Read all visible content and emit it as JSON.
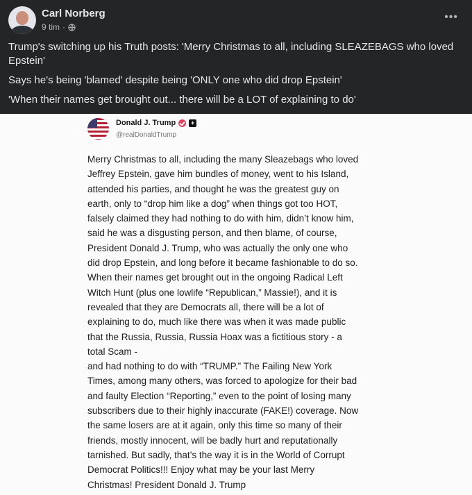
{
  "post": {
    "author": "Carl Norberg",
    "time": "9 tim",
    "separator": "·",
    "privacy_icon": "globe-icon",
    "more_icon": "more-options-icon",
    "more_label": "•••",
    "paragraphs": [
      "Trump's switching up his Truth posts: 'Merry Christmas to all, including SLEAZEBAGS who loved Epstein'",
      "Says he's being 'blamed' despite being 'ONLY one who did drop Epstein'",
      "'When their names get brought out... there will be a LOT of explaining to do'"
    ]
  },
  "truth": {
    "name": "Donald J. Trump",
    "handle": "@realDonaldTrump",
    "plus_label": "+",
    "lines": [
      "Merry Christmas to all, including the many Sleazebags who loved",
      "Jeffrey Epstein, gave him bundles of money, went to his Island,",
      "attended his parties, and thought he was the greatest guy on",
      "earth, only to “drop him like a dog” when things got too HOT,",
      "falsely claimed they had nothing to do with him, didn’t know him,",
      "said he was a disgusting person, and then blame, of course,",
      "President Donald J. Trump, who was actually the only one who",
      "did drop Epstein, and long before it became fashionable to do so.",
      "When their names get brought out in the ongoing Radical Left",
      "Witch Hunt (plus one lowlife “Republican,” Massie!), and it is",
      "revealed that they are Democrats all, there will be a lot of",
      "explaining to do, much like there was when it was made public",
      "that the Russia, Russia, Russia Hoax was a fictitious story - a",
      "total Scam -",
      "and had nothing to do with “TRUMP.” The Failing New York",
      "Times, among many others, was forced to apologize for their bad",
      "and faulty Election “Reporting,” even to the point of losing many",
      "subscribers due to their highly inaccurate (FAKE!) coverage. Now",
      "the same losers are at it again, only this time so many of their",
      "friends, mostly innocent, will be badly hurt and reputationally",
      "tarnished. But sadly, that’s the way it is in the World of Corrupt",
      "Democrat Politics!!! Enjoy what may be your last Merry",
      "Christmas! President Donald J. Trump"
    ]
  },
  "colors": {
    "background": "#242526",
    "text": "#e4e6eb",
    "secondary_text": "#b0b3b8",
    "image_background": "#fbfbfb",
    "verified_badge": "#e4405f"
  }
}
